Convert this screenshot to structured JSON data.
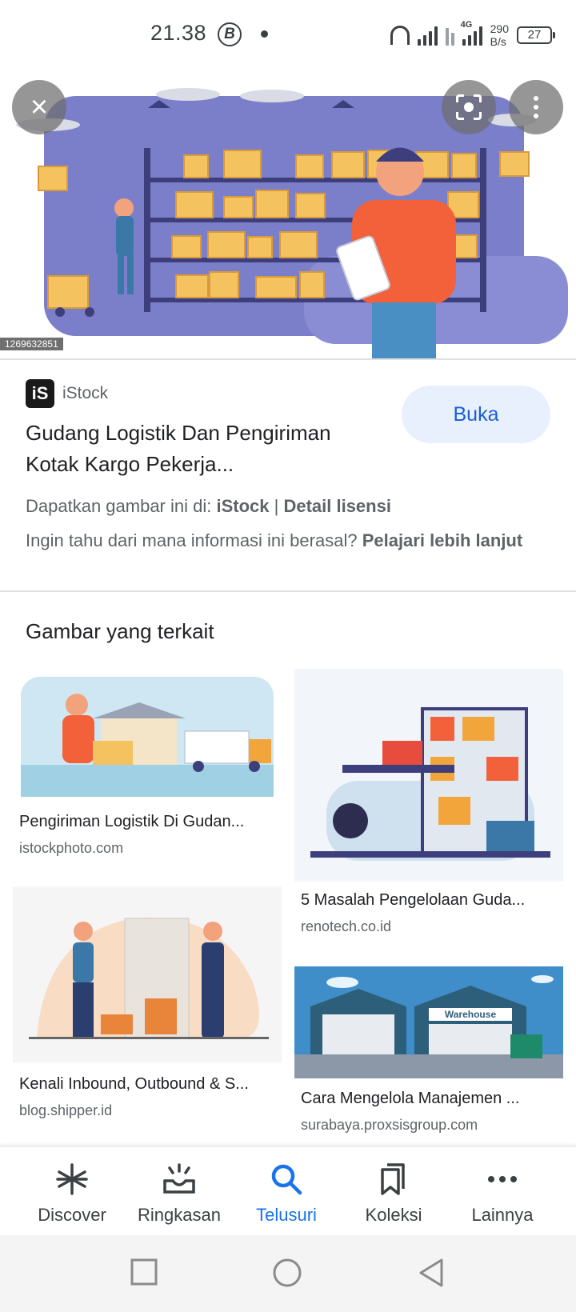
{
  "status_bar": {
    "time": "21.38",
    "b_icon": "B",
    "network_type": "4G",
    "net_speed_value": "290",
    "net_speed_unit": "B/s",
    "battery": "27"
  },
  "hero": {
    "image_id": "1269632851",
    "close_icon": "close-icon",
    "lens_icon": "lens-icon",
    "more_icon": "more-vert-icon"
  },
  "result": {
    "source_logo": "iS",
    "source_name": "iStock",
    "title": "Gudang Logistik Dan Pengiriman Kotak Kargo Pekerja...",
    "open_button": "Buka",
    "license_prefix": "Dapatkan gambar ini di: ",
    "license_source": "iStock",
    "license_sep": " | ",
    "license_detail": "Detail lisensi",
    "learn_prefix": "Ingin tahu dari mana informasi ini berasal? ",
    "learn_link": "Pelajari lebih lanjut"
  },
  "related": {
    "heading": "Gambar yang terkait",
    "items": [
      {
        "title": "Pengiriman Logistik Di Gudan...",
        "site": "istockphoto.com"
      },
      {
        "title": "5 Masalah Pengelolaan Guda...",
        "site": "renotech.co.id"
      },
      {
        "title": "Kenali Inbound, Outbound & S...",
        "site": "blog.shipper.id"
      },
      {
        "title": "Cara Mengelola Manajemen ...",
        "site": "surabaya.proxsisgroup.com",
        "sign": "Warehouse"
      }
    ]
  },
  "bottom_nav": {
    "items": [
      {
        "label": "Discover",
        "icon": "asterisk-icon"
      },
      {
        "label": "Ringkasan",
        "icon": "tray-icon"
      },
      {
        "label": "Telusuri",
        "icon": "search-icon",
        "active": true
      },
      {
        "label": "Koleksi",
        "icon": "bookmarks-icon"
      },
      {
        "label": "Lainnya",
        "icon": "more-horiz-icon"
      }
    ]
  },
  "system_nav": {
    "recents_icon": "square-icon",
    "home_icon": "circle-icon",
    "back_icon": "triangle-back-icon"
  },
  "colors": {
    "accent": "#1a73e8",
    "button_bg": "#e8f0fe",
    "text_primary": "#202124",
    "text_secondary": "#5f6368"
  }
}
